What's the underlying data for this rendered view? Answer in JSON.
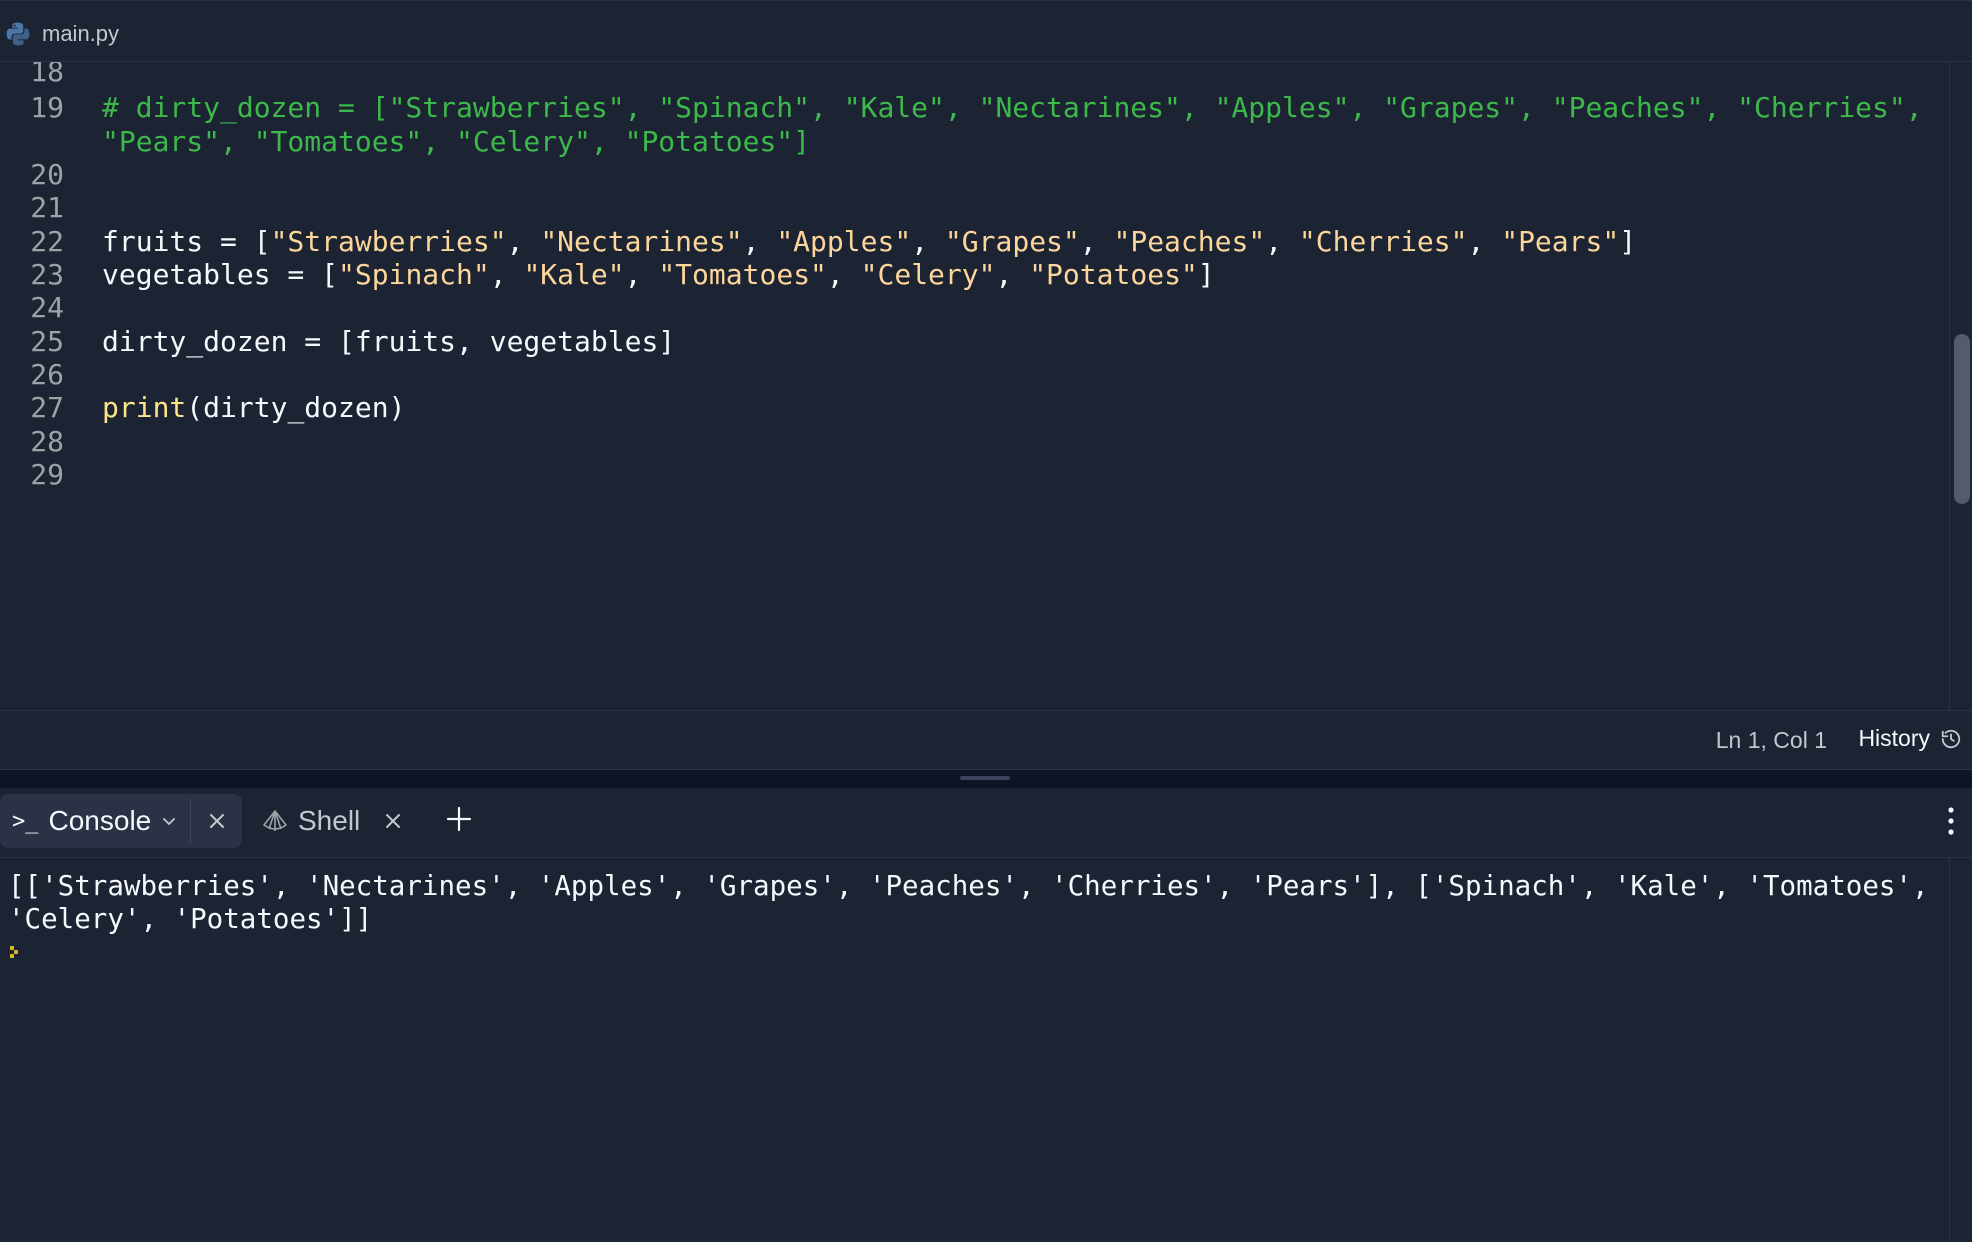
{
  "file_tab": {
    "name": "main.py",
    "icon": "python-icon"
  },
  "editor": {
    "lines": [
      {
        "num": "18",
        "tokens": []
      },
      {
        "num": "19",
        "tokens": [
          {
            "t": "# dirty_dozen = [\"Strawberries\", \"Spinach\", \"Kale\", \"Nectarines\", \"Apples\", \"Grapes\", \"Peaches\", \"Cherries\",",
            "c": "comment"
          }
        ]
      },
      {
        "num": "",
        "tokens": [
          {
            "t": "\"Pears\", \"Tomatoes\", \"Celery\", \"Potatoes\"]",
            "c": "comment"
          }
        ]
      },
      {
        "num": "20",
        "tokens": []
      },
      {
        "num": "21",
        "tokens": []
      },
      {
        "num": "22",
        "tokens": [
          {
            "t": "fruits = [",
            "c": "plain"
          },
          {
            "t": "\"Strawberries\"",
            "c": "str"
          },
          {
            "t": ", ",
            "c": "plain"
          },
          {
            "t": "\"Nectarines\"",
            "c": "str"
          },
          {
            "t": ", ",
            "c": "plain"
          },
          {
            "t": "\"Apples\"",
            "c": "str"
          },
          {
            "t": ", ",
            "c": "plain"
          },
          {
            "t": "\"Grapes\"",
            "c": "str"
          },
          {
            "t": ", ",
            "c": "plain"
          },
          {
            "t": "\"Peaches\"",
            "c": "str"
          },
          {
            "t": ", ",
            "c": "plain"
          },
          {
            "t": "\"Cherries\"",
            "c": "str"
          },
          {
            "t": ", ",
            "c": "plain"
          },
          {
            "t": "\"Pears\"",
            "c": "str"
          },
          {
            "t": "]",
            "c": "plain"
          }
        ]
      },
      {
        "num": "23",
        "tokens": [
          {
            "t": "vegetables = [",
            "c": "plain"
          },
          {
            "t": "\"Spinach\"",
            "c": "str"
          },
          {
            "t": ", ",
            "c": "plain"
          },
          {
            "t": "\"Kale\"",
            "c": "str"
          },
          {
            "t": ", ",
            "c": "plain"
          },
          {
            "t": "\"Tomatoes\"",
            "c": "str"
          },
          {
            "t": ", ",
            "c": "plain"
          },
          {
            "t": "\"Celery\"",
            "c": "str"
          },
          {
            "t": ", ",
            "c": "plain"
          },
          {
            "t": "\"Potatoes\"",
            "c": "str"
          },
          {
            "t": "]",
            "c": "plain"
          }
        ]
      },
      {
        "num": "24",
        "tokens": []
      },
      {
        "num": "25",
        "tokens": [
          {
            "t": "dirty_dozen = [fruits, vegetables]",
            "c": "plain"
          }
        ]
      },
      {
        "num": "26",
        "tokens": []
      },
      {
        "num": "27",
        "tokens": [
          {
            "t": "print",
            "c": "fn"
          },
          {
            "t": "(dirty_dozen)",
            "c": "plain"
          }
        ]
      },
      {
        "num": "28",
        "tokens": []
      },
      {
        "num": "29",
        "tokens": []
      }
    ]
  },
  "status_bar": {
    "cursor_position": "Ln 1, Col 1",
    "history_label": "History"
  },
  "console_panel": {
    "tabs": [
      {
        "label": "Console",
        "icon": "terminal-prompt-icon",
        "active": true
      },
      {
        "label": "Shell",
        "icon": "shell-icon",
        "active": false
      }
    ],
    "output": "[['Strawberries', 'Nectarines', 'Apples', 'Grapes', 'Peaches', 'Cherries', 'Pears'], ['Spinach', 'Kale', 'Tomatoes', 'Celery', 'Potatoes']]"
  },
  "colors": {
    "background": "#1c2333",
    "comment": "#3db84a",
    "string": "#fcd69b",
    "function": "#fce588",
    "prompt": "#d4b52b"
  }
}
